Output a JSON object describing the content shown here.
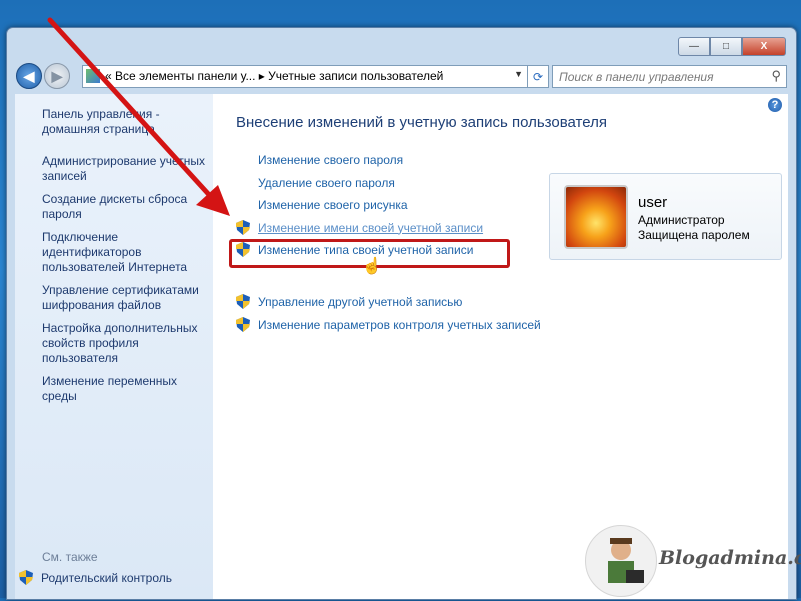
{
  "window": {
    "controls": {
      "minimize": "—",
      "maximize": "□",
      "close": "X"
    }
  },
  "nav": {
    "address": "« Все элементы панели у... ▸ Учетные записи пользователей",
    "search_placeholder": "Поиск в панели управления",
    "icons": [
      "back-arrow-icon",
      "forward-arrow-icon",
      "control-panel-icon",
      "refresh-icon",
      "search-icon"
    ]
  },
  "sidebar": {
    "items": [
      {
        "label": "Панель управления - домашняя страница"
      },
      {
        "label": "Администрирование учетных записей"
      },
      {
        "label": "Создание дискеты сброса пароля"
      },
      {
        "label": "Подключение идентификаторов пользователей Интернета"
      },
      {
        "label": "Управление сертификатами шифрования файлов"
      },
      {
        "label": "Настройка дополнительных свойств профиля пользователя"
      },
      {
        "label": "Изменение переменных среды"
      }
    ],
    "see_also": "См. также",
    "parental_control": "Родительский контроль"
  },
  "main": {
    "heading": "Внесение изменений в учетную запись пользователя",
    "links": [
      {
        "label": "Изменение своего пароля"
      },
      {
        "label": "Удаление своего пароля"
      },
      {
        "label": "Изменение своего рисунка"
      },
      {
        "label": "Изменение имени своей учетной записи"
      },
      {
        "label": "Изменение типа своей учетной записи"
      },
      {
        "label": "Управление другой учетной записью"
      },
      {
        "label": "Изменение параметров контроля учетных записей"
      }
    ],
    "help": "?"
  },
  "user_card": {
    "name": "user",
    "role": "Администратор",
    "status": "Защищена паролем"
  },
  "watermark": {
    "text": "Blogadmina.com"
  },
  "colors": {
    "link": "#1f63a8",
    "highlight": "#c01818",
    "heading": "#1e3f76"
  }
}
